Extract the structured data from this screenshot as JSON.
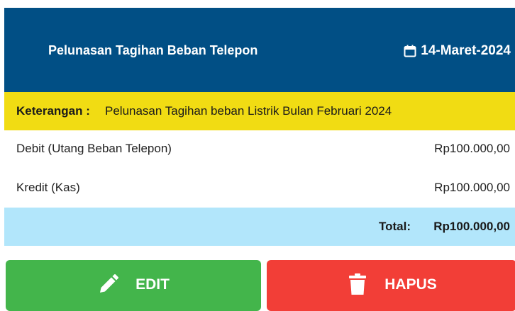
{
  "header": {
    "title": "Pelunasan Tagihan Beban Telepon",
    "date": "14-Maret-2024",
    "date_icon": "calendar-icon",
    "background_color": "#014f85"
  },
  "note": {
    "label": "Keterangan :",
    "text": "Pelunasan Tagihan beban Listrik Bulan Februari 2024",
    "background_color": "#f1dc13"
  },
  "entries": [
    {
      "label": "Debit (Utang Beban Telepon)",
      "amount": "Rp100.000,00"
    },
    {
      "label": "Kredit (Kas)",
      "amount": "Rp100.000,00"
    }
  ],
  "total": {
    "label": "Total:",
    "amount": "Rp100.000,00",
    "background_color": "#b2e6fb"
  },
  "actions": {
    "edit_label": "EDIT",
    "edit_icon": "pencil-icon",
    "edit_color": "#43b54b",
    "delete_label": "HAPUS",
    "delete_icon": "trash-icon",
    "delete_color": "#f23e37"
  }
}
